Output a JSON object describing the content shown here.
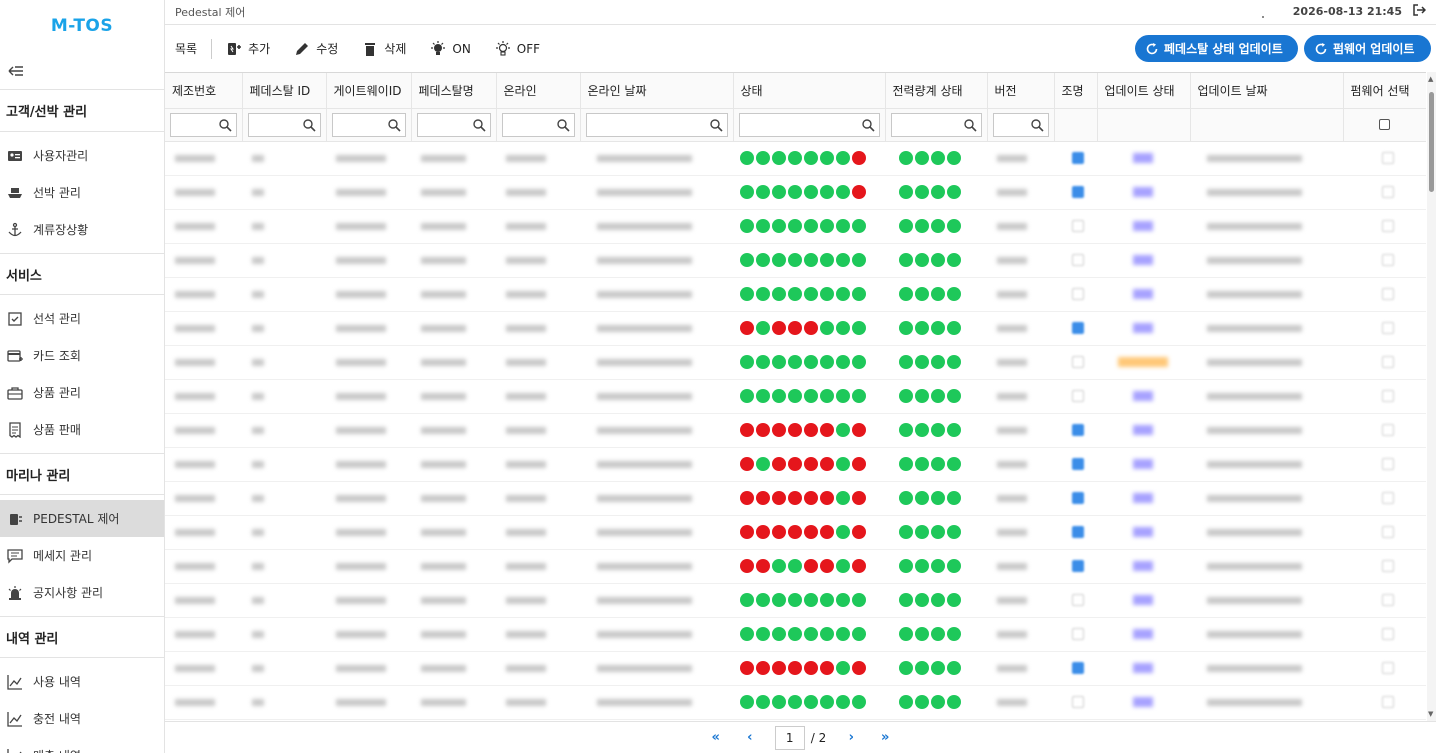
{
  "app": {
    "logo": "M-TOS"
  },
  "topbar": {
    "breadcrumb": "Pedestal 제어",
    "datetime": "2026-08-13 21:45"
  },
  "sidebar": {
    "sections": [
      {
        "title": "고객/선박 관리",
        "items": [
          {
            "label": "사용자관리",
            "icon": "user-card-icon"
          },
          {
            "label": "선박 관리",
            "icon": "ship-icon"
          },
          {
            "label": "계류장상황",
            "icon": "anchor-icon"
          }
        ]
      },
      {
        "title": "서비스",
        "items": [
          {
            "label": "선석 관리",
            "icon": "berth-check-icon"
          },
          {
            "label": "카드 조회",
            "icon": "card-icon"
          },
          {
            "label": "상품 관리",
            "icon": "briefcase-icon"
          },
          {
            "label": "상품 판매",
            "icon": "receipt-icon"
          }
        ]
      },
      {
        "title": "마리나 관리",
        "items": [
          {
            "label": "PEDESTAL 제어",
            "icon": "pedestal-icon",
            "active": true
          },
          {
            "label": "메세지 관리",
            "icon": "message-icon"
          },
          {
            "label": "공지사항 관리",
            "icon": "alarm-icon"
          }
        ]
      },
      {
        "title": "내역 관리",
        "items": [
          {
            "label": "사용 내역",
            "icon": "chart-line-icon"
          },
          {
            "label": "충전 내역",
            "icon": "chart-line-icon"
          },
          {
            "label": "매출 내역",
            "icon": "chart-line-icon"
          }
        ]
      }
    ]
  },
  "toolbar": {
    "list_label": "목록",
    "add_label": "추가",
    "edit_label": "수정",
    "delete_label": "삭제",
    "on_label": "ON",
    "off_label": "OFF",
    "status_update_label": "페데스탈 상태 업데이트",
    "firmware_update_label": "펌웨어 업데이트"
  },
  "table": {
    "columns": [
      "제조번호",
      "페데스탈 ID",
      "게이트웨이ID",
      "페데스탈명",
      "온라인",
      "온라인 날짜",
      "상태",
      "전력량계 상태",
      "버전",
      "조명",
      "업데이트 상태",
      "업데이트 날짜",
      "펌웨어 선택"
    ],
    "rows": [
      {
        "status": "GGGGGGGR",
        "meter": "GGGG",
        "lamp": true,
        "update": "done"
      },
      {
        "status": "GGGGGGGR",
        "meter": "GGGG",
        "lamp": true,
        "update": "done"
      },
      {
        "status": "GGGGGGGG",
        "meter": "GGGG",
        "lamp": false,
        "update": "done"
      },
      {
        "status": "GGGGGGGG",
        "meter": "GGGG",
        "lamp": false,
        "update": "done"
      },
      {
        "status": "GGGGGGGG",
        "meter": "GGGG",
        "lamp": false,
        "update": "done"
      },
      {
        "status": "RGRRRGGG",
        "meter": "GGGG",
        "lamp": true,
        "update": "done"
      },
      {
        "status": "GGGGGGGG",
        "meter": "GGGG",
        "lamp": false,
        "update": "busy"
      },
      {
        "status": "GGGGGGGG",
        "meter": "GGGG",
        "lamp": false,
        "update": "done"
      },
      {
        "status": "RRRRRRGR",
        "meter": "GGGG",
        "lamp": true,
        "update": "done"
      },
      {
        "status": "RGRRRRGR",
        "meter": "GGGG",
        "lamp": true,
        "update": "done"
      },
      {
        "status": "RRRRRRGR",
        "meter": "GGGG",
        "lamp": true,
        "update": "done"
      },
      {
        "status": "RRRRRRGR",
        "meter": "GGGG",
        "lamp": true,
        "update": "done"
      },
      {
        "status": "RRGGRRGR",
        "meter": "GGGG",
        "lamp": true,
        "update": "done"
      },
      {
        "status": "GGGGGGGG",
        "meter": "GGGG",
        "lamp": false,
        "update": "done"
      },
      {
        "status": "GGGGGGGG",
        "meter": "GGGG",
        "lamp": false,
        "update": "done"
      },
      {
        "status": "RRRRRRGR",
        "meter": "GGGG",
        "lamp": true,
        "update": "done"
      },
      {
        "status": "GGGGGGGG",
        "meter": "GGGG",
        "lamp": false,
        "update": "done"
      }
    ]
  },
  "pager": {
    "current": "1",
    "total": "/ 2"
  }
}
